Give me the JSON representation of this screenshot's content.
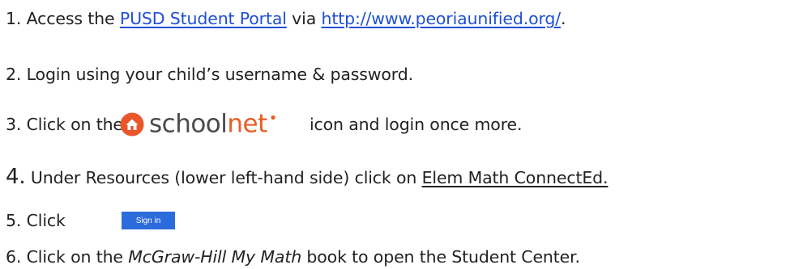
{
  "steps": [
    {
      "number": "1.",
      "text_before": "Access the ",
      "link1": "PUSD Student Portal",
      "text_middle": " via ",
      "link2": "http://www.peoriaunified.org/",
      "text_after": "."
    },
    {
      "number": "2.",
      "text": "Login using your child’s username & password."
    },
    {
      "number": "3.",
      "text_before": "Click on the",
      "text_after": "icon and login once more."
    },
    {
      "number": "4.",
      "text_before": "Under Resources (lower left-hand side) click on ",
      "underlined": "Elem Math ConnectEd."
    },
    {
      "number": "5.",
      "text": "Click"
    },
    {
      "number": "6.",
      "text_before": "Click on the ",
      "italic": "McGraw-Hill My Math",
      "text_after": " book to open the Student Center."
    }
  ],
  "schoolnet": {
    "icon": "house-icon",
    "word_school": "school",
    "word_net": "net",
    "dot": "•",
    "colors": {
      "circle": "#e8562a",
      "school": "#4a4a4a",
      "net": "#e85d24"
    }
  },
  "signin_button": {
    "label": "Sign in",
    "color": "#2b6bdc"
  },
  "link_color": "#1f4fd6"
}
